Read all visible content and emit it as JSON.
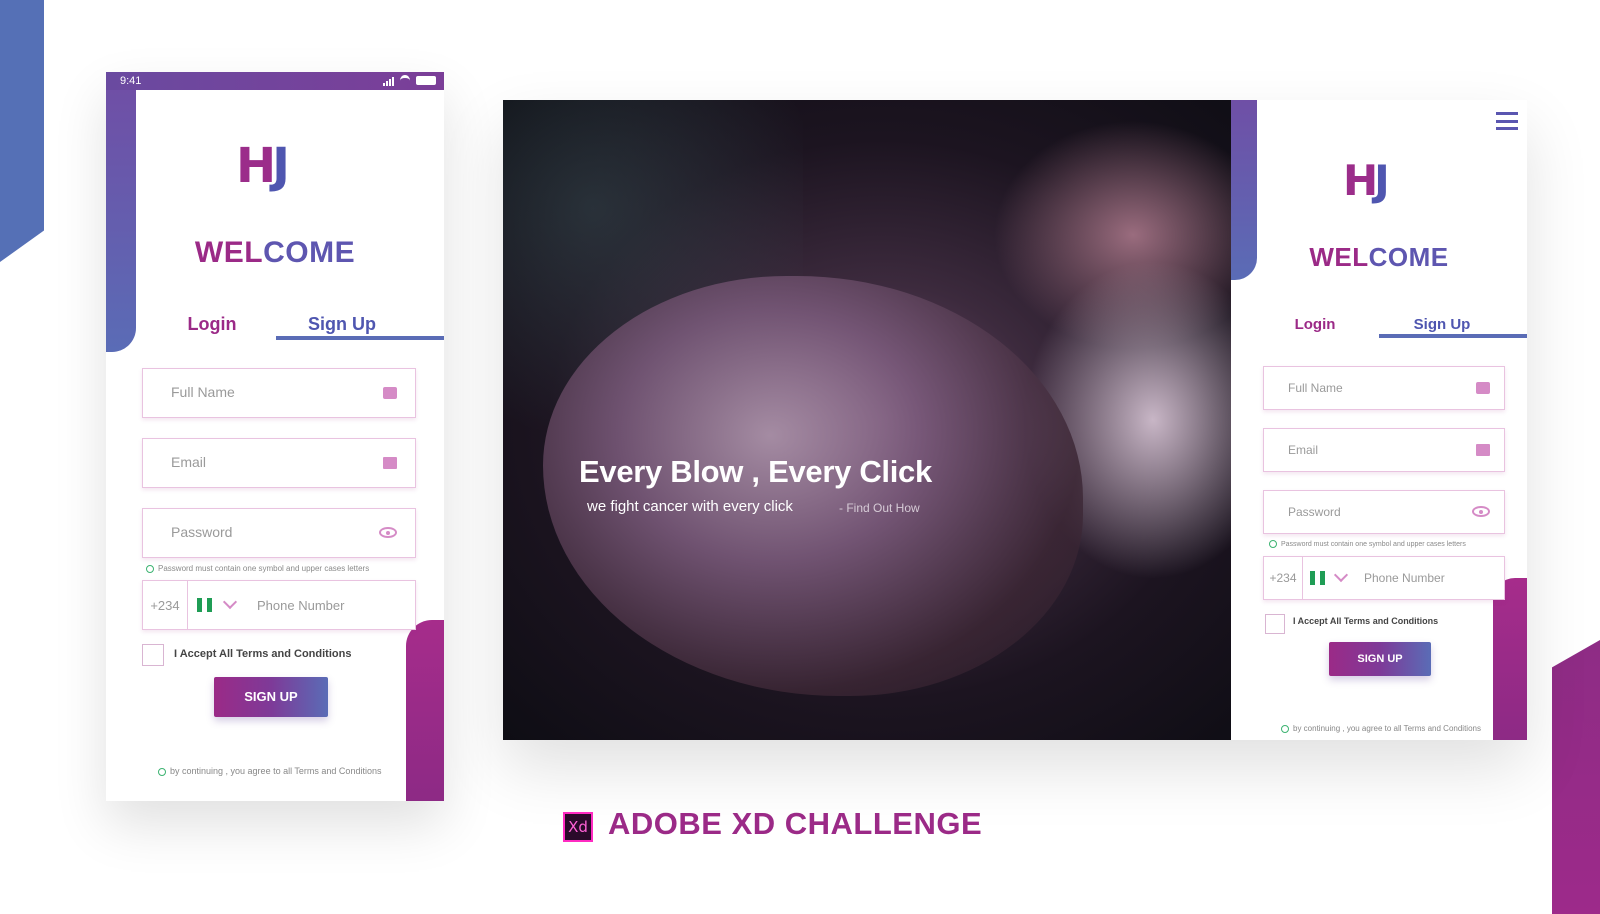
{
  "brand": {
    "logo_h": "H",
    "logo_t": "J",
    "welcome_part1": "WEL",
    "welcome_part2": "COME"
  },
  "mobile": {
    "time": "9:41",
    "tabs": {
      "login": "Login",
      "signup": "Sign Up"
    },
    "fields": {
      "full_name": "Full Name",
      "email": "Email",
      "password": "Password",
      "password_hint": "Password must contain one symbol and upper cases letters",
      "country_code": "+234",
      "phone": "Phone Number"
    },
    "terms": "I Accept All Terms and Conditions",
    "signup_button": "SIGN UP",
    "footer": "by continuing , you agree to all Terms and Conditions"
  },
  "desktop": {
    "hero": {
      "headline": "Every Blow , Every Click",
      "subline": "we fight cancer with every click",
      "link": "- Find Out How"
    },
    "tabs": {
      "login": "Login",
      "signup": "Sign Up"
    },
    "fields": {
      "full_name": "Full Name",
      "email": "Email",
      "password": "Password",
      "password_hint": "Password must contain one symbol and upper cases letters",
      "country_code": "+234",
      "phone": "Phone Number"
    },
    "terms": "I Accept All Terms and Conditions",
    "signup_button": "SIGN UP",
    "footer": "by continuing , you agree to all Terms and Conditions"
  },
  "caption": {
    "xd_icon": "Xd",
    "title": "ADOBE XD CHALLENGE"
  },
  "colors": {
    "purple": "#9b2a87",
    "blue": "#5a6cb6",
    "field_border": "#e9c3e0",
    "icon_pink": "#d58bc6",
    "flag_green": "#1f9d55"
  },
  "icons": [
    "calendar-icon",
    "mail-icon",
    "eye-icon",
    "chevron-down-icon",
    "menu-icon",
    "info-icon",
    "adobe-xd-icon"
  ]
}
